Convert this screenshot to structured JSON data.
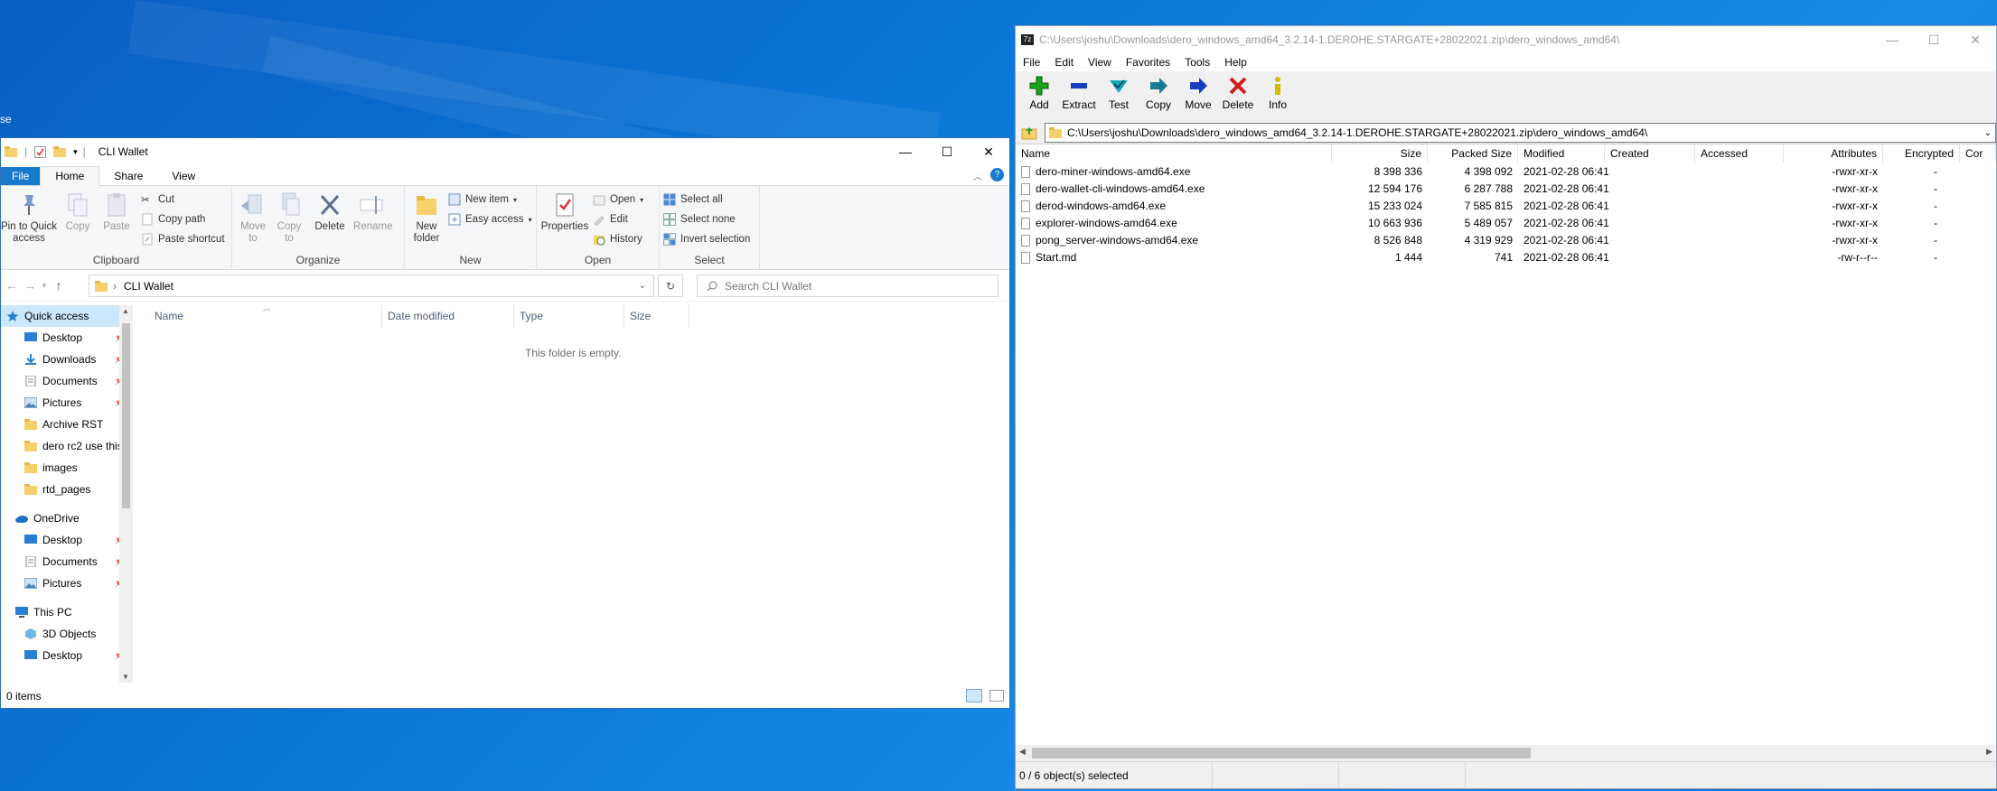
{
  "desktop": {
    "edge_text": "se"
  },
  "explorer": {
    "title": "CLI Wallet",
    "tabs": {
      "file": "File",
      "home": "Home",
      "share": "Share",
      "view": "View"
    },
    "ribbon": {
      "clipboard": {
        "label": "Clipboard",
        "pin": "Pin to Quick access",
        "copy": "Copy",
        "paste": "Paste",
        "cut": "Cut",
        "copy_path": "Copy path",
        "paste_shortcut": "Paste shortcut"
      },
      "organize": {
        "label": "Organize",
        "move_to": "Move to",
        "copy_to": "Copy to",
        "delete": "Delete",
        "rename": "Rename"
      },
      "new": {
        "label": "New",
        "new_folder": "New folder",
        "new_item": "New item",
        "easy_access": "Easy access"
      },
      "open": {
        "label": "Open",
        "properties": "Properties",
        "open": "Open",
        "edit": "Edit",
        "history": "History"
      },
      "select": {
        "label": "Select",
        "select_all": "Select all",
        "select_none": "Select none",
        "invert": "Invert selection"
      }
    },
    "address": {
      "current": "CLI Wallet"
    },
    "search": {
      "placeholder": "Search CLI Wallet"
    },
    "nav": {
      "quick_access": "Quick access",
      "qa_items": [
        "Desktop",
        "Downloads",
        "Documents",
        "Pictures",
        "Archive RST",
        "dero rc2 use this",
        "images",
        "rtd_pages"
      ],
      "onedrive": "OneDrive",
      "od_items": [
        "Desktop",
        "Documents",
        "Pictures"
      ],
      "this_pc": "This PC",
      "pc_items": [
        "3D Objects",
        "Desktop"
      ]
    },
    "columns": {
      "name": "Name",
      "date": "Date modified",
      "type": "Type",
      "size": "Size"
    },
    "empty_text": "This folder is empty.",
    "status": "0 items"
  },
  "sevenzip": {
    "title": "C:\\Users\\joshu\\Downloads\\dero_windows_amd64_3.2.14-1.DEROHE.STARGATE+28022021.zip\\dero_windows_amd64\\",
    "menu": [
      "File",
      "Edit",
      "View",
      "Favorites",
      "Tools",
      "Help"
    ],
    "toolbar": [
      {
        "label": "Add",
        "icon": "add-icon",
        "color": "#1aa31a"
      },
      {
        "label": "Extract",
        "icon": "extract-icon",
        "color": "#1a3cc0"
      },
      {
        "label": "Test",
        "icon": "test-icon",
        "color": "#19a7b8"
      },
      {
        "label": "Copy",
        "icon": "copy-icon",
        "color": "#1a7a9a"
      },
      {
        "label": "Move",
        "icon": "move-icon",
        "color": "#1a3cc0"
      },
      {
        "label": "Delete",
        "icon": "delete-icon",
        "color": "#d01c1c"
      },
      {
        "label": "Info",
        "icon": "info-icon",
        "color": "#d8b800"
      }
    ],
    "path": "C:\\Users\\joshu\\Downloads\\dero_windows_amd64_3.2.14-1.DEROHE.STARGATE+28022021.zip\\dero_windows_amd64\\",
    "columns": [
      "Name",
      "Size",
      "Packed Size",
      "Modified",
      "Created",
      "Accessed",
      "Attributes",
      "Encrypted",
      "Cor"
    ],
    "files": [
      {
        "name": "dero-miner-windows-amd64.exe",
        "size": "8 398 336",
        "packed": "4 398 092",
        "modified": "2021-02-28 06:41",
        "attributes": "-rwxr-xr-x",
        "encrypted": "-"
      },
      {
        "name": "dero-wallet-cli-windows-amd64.exe",
        "size": "12 594 176",
        "packed": "6 287 788",
        "modified": "2021-02-28 06:41",
        "attributes": "-rwxr-xr-x",
        "encrypted": "-"
      },
      {
        "name": "derod-windows-amd64.exe",
        "size": "15 233 024",
        "packed": "7 585 815",
        "modified": "2021-02-28 06:41",
        "attributes": "-rwxr-xr-x",
        "encrypted": "-"
      },
      {
        "name": "explorer-windows-amd64.exe",
        "size": "10 663 936",
        "packed": "5 489 057",
        "modified": "2021-02-28 06:41",
        "attributes": "-rwxr-xr-x",
        "encrypted": "-"
      },
      {
        "name": "pong_server-windows-amd64.exe",
        "size": "8 526 848",
        "packed": "4 319 929",
        "modified": "2021-02-28 06:41",
        "attributes": "-rwxr-xr-x",
        "encrypted": "-"
      },
      {
        "name": "Start.md",
        "size": "1 444",
        "packed": "741",
        "modified": "2021-02-28 06:41",
        "attributes": "-rw-r--r--",
        "encrypted": "-"
      }
    ],
    "status": "0 / 6 object(s) selected"
  }
}
